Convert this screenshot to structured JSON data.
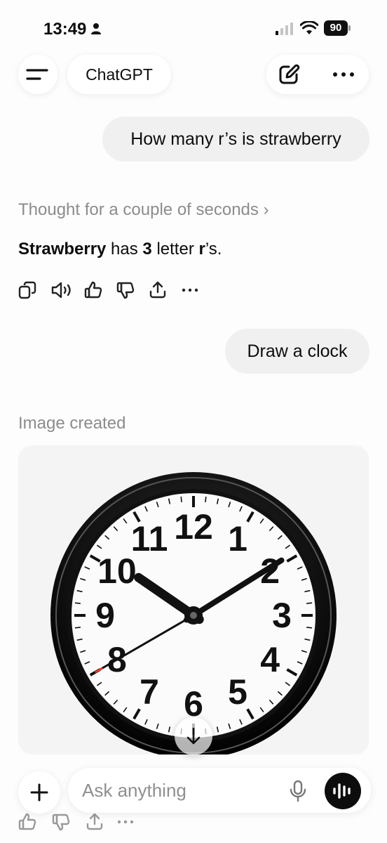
{
  "status_bar": {
    "time": "13:49",
    "battery": "90"
  },
  "header": {
    "title": "ChatGPT"
  },
  "messages": {
    "user_1": "How many r’s is strawberry",
    "thought": "Thought for a couple of seconds",
    "thought_chevron": "›",
    "answer": {
      "word": "Strawberry",
      "has": " has ",
      "count": "3",
      "letter_text": " letter ",
      "letter": "r",
      "suffix": "’s."
    },
    "user_2": "Draw a clock",
    "image_created": "Image created"
  },
  "clock": {
    "numerals": [
      "12",
      "1",
      "2",
      "3",
      "4",
      "5",
      "6",
      "7",
      "8",
      "9",
      "10",
      "11"
    ],
    "time_shown": "10:09:40"
  },
  "composer": {
    "placeholder": "Ask anything"
  },
  "icons": {
    "menu": "menu-icon",
    "new_chat": "new-chat-icon",
    "more": "more-icon",
    "copy": "copy-icon",
    "read_aloud": "speaker-icon",
    "thumbs_up": "thumbs-up-icon",
    "thumbs_down": "thumbs-down-icon",
    "share": "share-icon",
    "plus": "plus-icon",
    "mic": "mic-icon",
    "voice": "voice-mode-icon",
    "scroll_down": "arrow-down-icon"
  },
  "colors": {
    "accent": "#0d0d0d",
    "bubble": "#f0f0f0",
    "muted": "#8c8c8c",
    "clock_second_hand": "#e03c2e"
  }
}
